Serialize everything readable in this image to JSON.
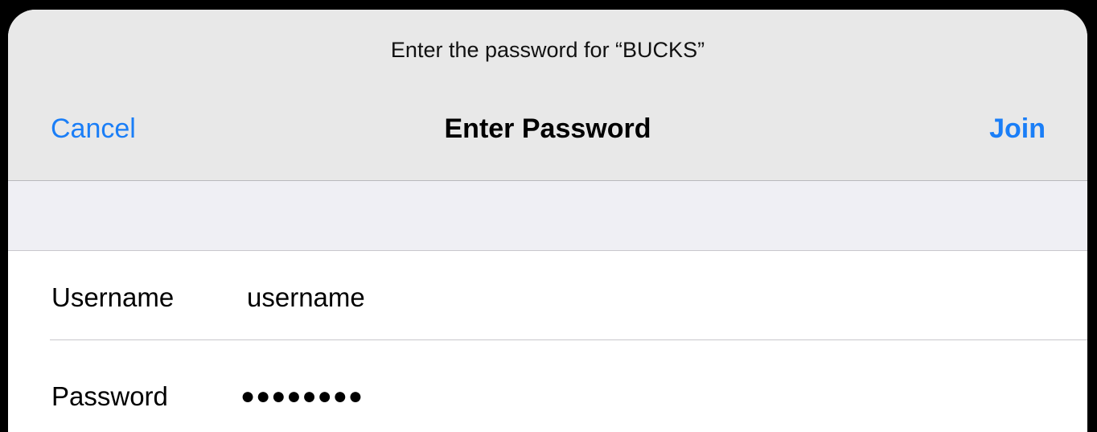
{
  "header": {
    "prompt": "Enter the password for “BUCKS”",
    "title": "Enter Password",
    "cancel_label": "Cancel",
    "join_label": "Join"
  },
  "form": {
    "username": {
      "label": "Username",
      "value": "username"
    },
    "password": {
      "label": "Password",
      "value": "●●●●●●●●"
    }
  },
  "colors": {
    "accent": "#1a7ef7",
    "nav_background": "#e8e8e8",
    "group_background": "#efeff4",
    "separator": "#c8c7cc"
  }
}
